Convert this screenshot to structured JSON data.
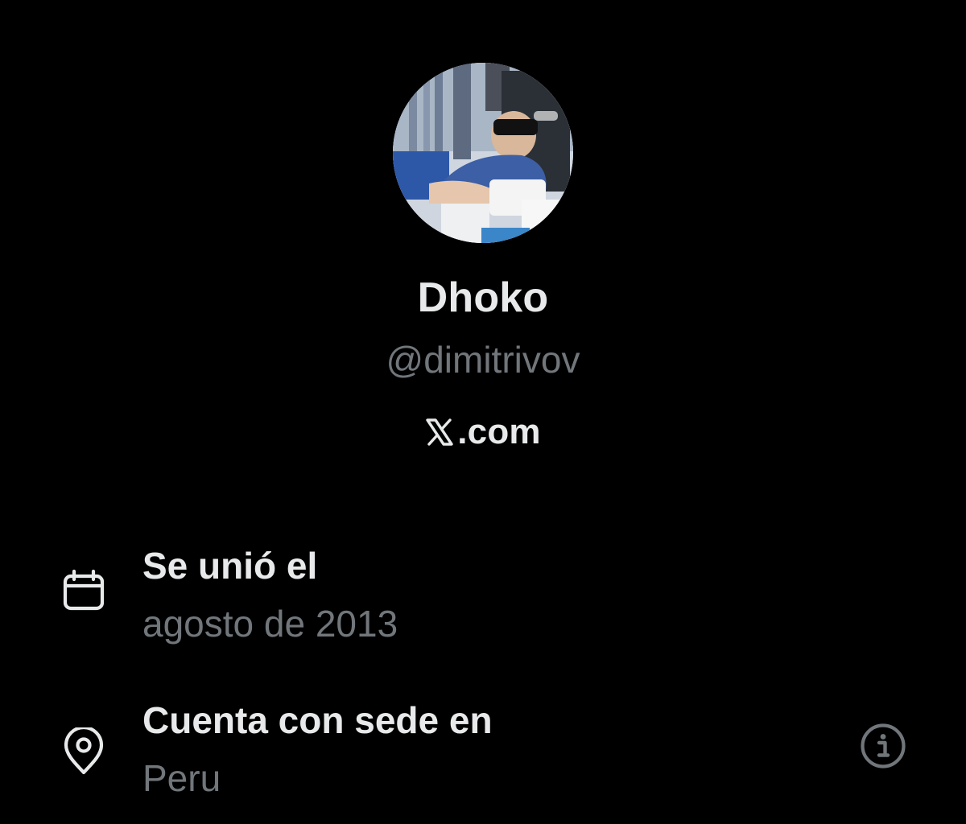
{
  "profile": {
    "display_name": "Dhoko",
    "handle": "@dimitrivov",
    "site_label": ".com",
    "avatar_icon": "profile-photo"
  },
  "about": {
    "joined": {
      "icon": "calendar-icon",
      "title": "Se unió el",
      "value": "agosto de 2013"
    },
    "location": {
      "icon": "location-pin-icon",
      "title": "Cuenta con sede en",
      "value": "Peru",
      "info_icon": "info-icon"
    }
  },
  "colors": {
    "background": "#000000",
    "primary_text": "#e7e9ea",
    "secondary_text": "#71767b"
  }
}
